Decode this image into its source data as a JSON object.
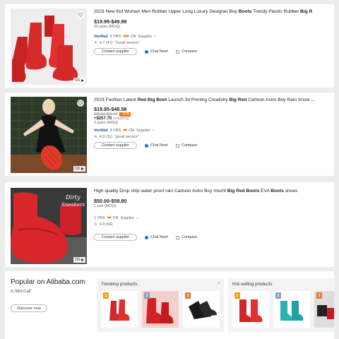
{
  "products": [
    {
      "title_parts": [
        {
          "t": "2023 New Kid Women Men Rubber Upper Long Luxury Designer Boy ",
          "b": false
        },
        {
          "t": "Boots",
          "b": true
        },
        {
          "t": " Trendy Plastic Rubber ",
          "b": false
        },
        {
          "t": "Big R",
          "b": true
        }
      ],
      "price": "$19.99-$49.99",
      "moq": "50 pairs (MOQ)",
      "verified": "Verified",
      "years": "5 YRS",
      "country": "CN",
      "supplier": "Supplier",
      "rating": "4.7 (41)",
      "review": "\"Good service\"",
      "contact": "Contact supplier",
      "chat": "Chat Now!",
      "compare": "Compare",
      "pager": "1/6"
    },
    {
      "title_parts": [
        {
          "t": "2023 Fashion Latest ",
          "b": false
        },
        {
          "t": "Red Big Boot",
          "b": true
        },
        {
          "t": " Launch 3d Printing Creativity ",
          "b": false
        },
        {
          "t": "Big Red",
          "b": true
        },
        {
          "t": " Cartoon Astro Boy Rain Snow ...",
          "b": false
        }
      ],
      "price": "$19.95-$48.58",
      "old_price": "$28.50-$69.40",
      "discount": "-30%",
      "shipping": "+$257.70",
      "shipping_label": "(shipping)",
      "moq": "2 pairs (MOQ)",
      "verified": "Verified",
      "years": "3 YRS",
      "country": "CN",
      "supplier": "Supplier",
      "rating": "4.9 (11)",
      "review": "\"great service\"",
      "contact": "Contact supplier",
      "chat": "Chat Now!",
      "compare": "Compare",
      "pager": "1/6"
    },
    {
      "title_parts": [
        {
          "t": "High quality Drop ship water proof rain Cartoon Astro Boy mschf ",
          "b": false
        },
        {
          "t": "Big Red Boots",
          "b": true
        },
        {
          "t": " EVA ",
          "b": false
        },
        {
          "t": "Boots",
          "b": true
        },
        {
          "t": " shoes",
          "b": false
        }
      ],
      "price": "$50.00-$59.80",
      "moq": "1 pair (MOQ)",
      "years": "1 YRS",
      "country": "CN",
      "supplier": "Supplier",
      "rating": "4.8 (54)",
      "contact": "Contact supplier",
      "chat": "Chat Now!",
      "compare": "Compare",
      "pager": "1/6"
    }
  ],
  "popular": {
    "title": "Popular on Alibaba.com",
    "subtitle": "in Mid-Calf",
    "discover": "Discover now",
    "trending": {
      "title": "Trending products",
      "arrow": "›",
      "ranks": [
        "1",
        "2",
        "3"
      ]
    },
    "hot": {
      "title": "Hot-selling products",
      "arrow": "›",
      "ranks": [
        "1",
        "2",
        "3"
      ]
    }
  },
  "colors": {
    "accent": "#ff6a00",
    "boot_red": "#d92b2b",
    "link_blue": "#1473e6"
  }
}
